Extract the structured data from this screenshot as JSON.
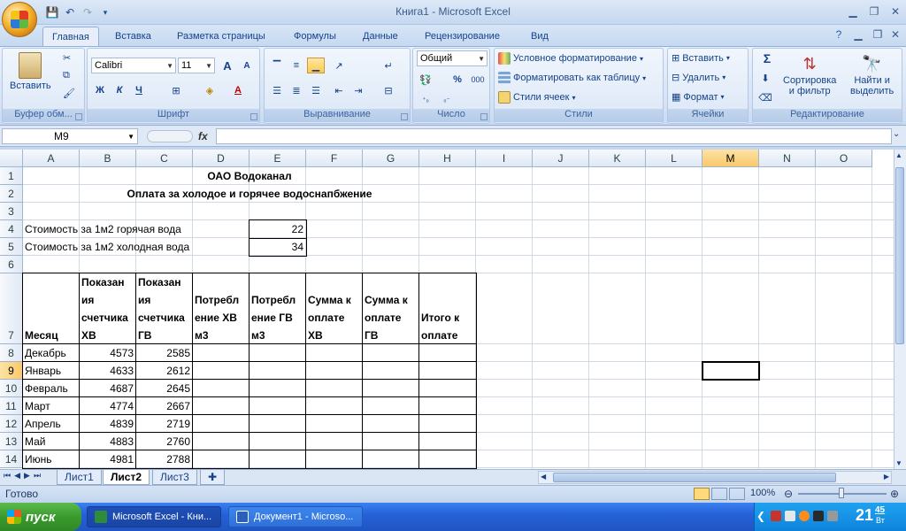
{
  "window": {
    "title": "Книга1 - Microsoft Excel"
  },
  "tabs": [
    "Главная",
    "Вставка",
    "Разметка страницы",
    "Формулы",
    "Данные",
    "Рецензирование",
    "Вид"
  ],
  "ribbon": {
    "clipboard": {
      "name": "Буфер обм...",
      "paste": "Вставить"
    },
    "font": {
      "name": "Шрифт",
      "font_name": "Calibri",
      "font_size": "11",
      "bold": "Ж",
      "italic": "К",
      "underline": "Ч",
      "grow": "A",
      "shrink": "A"
    },
    "alignment": {
      "name": "Выравнивание"
    },
    "number": {
      "name": "Число",
      "format": "Общий",
      "percent": "%",
      "thousands": "000"
    },
    "styles": {
      "name": "Стили",
      "conditional": "Условное форматирование",
      "as_table": "Форматировать как таблицу",
      "cell_styles": "Стили ячеек"
    },
    "cells": {
      "name": "Ячейки",
      "insert": "Вставить",
      "delete": "Удалить",
      "format": "Формат"
    },
    "editing": {
      "name": "Редактирование",
      "sort_line1": "Сортировка",
      "sort_line2": "и фильтр",
      "find_line1": "Найти и",
      "find_line2": "выделить",
      "sum": "Σ"
    }
  },
  "formula_bar": {
    "name_box": "M9",
    "fx": "fx",
    "content": ""
  },
  "columns": [
    "A",
    "B",
    "C",
    "D",
    "E",
    "F",
    "G",
    "H",
    "I",
    "J",
    "K",
    "L",
    "M",
    "N",
    "O"
  ],
  "rows": [
    "1",
    "2",
    "3",
    "4",
    "5",
    "6",
    "7",
    "8",
    "9",
    "10",
    "11",
    "12",
    "13",
    "14"
  ],
  "sheet": {
    "title1": "ОАО Водоканал",
    "title2": "Оплата за холодое и горячее водоснапбжение",
    "hot_label": "Стоимость за 1м2 горячая вода",
    "hot_value": "22",
    "cold_label": "Стоимость за 1м2 холодная вода",
    "cold_value": "34",
    "headers": {
      "month": "Месяц",
      "b": [
        "Показан",
        "ия",
        "счетчика",
        "ХВ"
      ],
      "c": [
        "Показан",
        "ия",
        "счетчика",
        "ГВ"
      ],
      "d": [
        "Потребл",
        "ение ХВ",
        "м3"
      ],
      "e": [
        "Потребл",
        "ение ГВ",
        "м3"
      ],
      "f": [
        "Сумма к",
        "оплате",
        "ХВ"
      ],
      "g": [
        "Сумма к",
        "оплате",
        "ГВ"
      ],
      "h": [
        "Итого к",
        "оплате"
      ]
    },
    "data": [
      {
        "month": "Декабрь",
        "hv": "4573",
        "gv": "2585"
      },
      {
        "month": "Январь",
        "hv": "4633",
        "gv": "2612"
      },
      {
        "month": "Февраль",
        "hv": "4687",
        "gv": "2645"
      },
      {
        "month": "Март",
        "hv": "4774",
        "gv": "2667"
      },
      {
        "month": "Апрель",
        "hv": "4839",
        "gv": "2719"
      },
      {
        "month": "Май",
        "hv": "4883",
        "gv": "2760"
      },
      {
        "month": "Июнь",
        "hv": "4981",
        "gv": "2788"
      }
    ]
  },
  "sheet_tabs": [
    "Лист1",
    "Лист2",
    "Лист3"
  ],
  "status": {
    "ready": "Готово",
    "zoom": "100%"
  },
  "taskbar": {
    "start": "пуск",
    "task1": "Microsoft Excel - Кни...",
    "task2": "Документ1 - Microso...",
    "clock_h": "21",
    "clock_m": "45",
    "clock_day": "Вт"
  }
}
